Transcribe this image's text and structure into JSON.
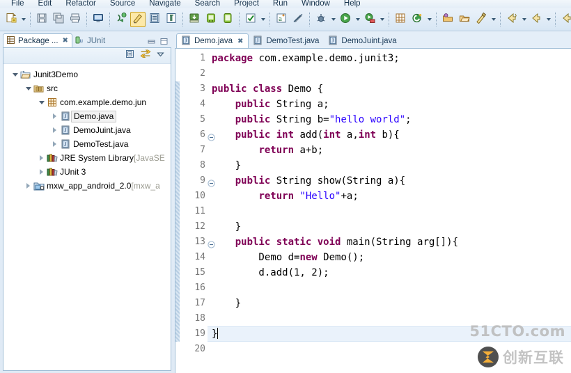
{
  "menu": {
    "items": [
      "File",
      "Edit",
      "Refactor",
      "Source",
      "Navigate",
      "Search",
      "Project",
      "Run",
      "Window",
      "Help"
    ]
  },
  "toolbar": {
    "groups": [
      {
        "buttons": [
          {
            "name": "new-wizard-icon",
            "label": "New"
          },
          {
            "name": "new-dropdown-arrow",
            "label": "New options"
          }
        ]
      },
      {
        "buttons": [
          {
            "name": "save-icon",
            "label": "Save"
          },
          {
            "name": "save-all-icon",
            "label": "Save All"
          },
          {
            "name": "print-icon",
            "label": "Print"
          }
        ]
      },
      {
        "buttons": [
          {
            "name": "open-console-icon",
            "label": "Open Console"
          }
        ]
      },
      {
        "buttons": [
          {
            "name": "new-java-class-icon",
            "label": "New Java Class"
          },
          {
            "name": "toggle-mark-occurrences-icon",
            "label": "Toggle Mark Occurrences"
          },
          {
            "name": "open-task-icon",
            "label": "Open Task"
          },
          {
            "name": "show-whitespace-icon",
            "label": "Show Whitespace Characters"
          }
        ]
      },
      {
        "buttons": [
          {
            "name": "import-icon",
            "label": "Import"
          },
          {
            "name": "android-sdk-manager-icon",
            "label": "Android SDK Manager"
          },
          {
            "name": "android-virtual-device-icon",
            "label": "Android Virtual Device Manager"
          }
        ]
      },
      {
        "buttons": [
          {
            "name": "check-icon",
            "label": "Validate"
          },
          {
            "name": "check-dropdown-arrow",
            "label": "Validate options"
          }
        ]
      },
      {
        "buttons": [
          {
            "name": "annotation-icon",
            "label": "Annotations"
          },
          {
            "name": "disable-icon",
            "label": "Skip All Breakpoints"
          }
        ]
      },
      {
        "buttons": [
          {
            "name": "debug-icon",
            "label": "Debug"
          },
          {
            "name": "debug-dropdown-arrow",
            "label": "Debug configurations"
          },
          {
            "name": "run-icon",
            "label": "Run"
          },
          {
            "name": "run-dropdown-arrow",
            "label": "Run configurations"
          },
          {
            "name": "run-coverage-icon",
            "label": "Coverage"
          },
          {
            "name": "coverage-dropdown-arrow",
            "label": "Coverage configurations"
          }
        ]
      },
      {
        "buttons": [
          {
            "name": "new-package-icon",
            "label": "New Package"
          },
          {
            "name": "new-project-icon",
            "label": "New Project"
          },
          {
            "name": "new-project-dropdown-arrow",
            "label": "New project options"
          }
        ]
      },
      {
        "buttons": [
          {
            "name": "open-type-icon",
            "label": "Open Type"
          },
          {
            "name": "open-resource-icon",
            "label": "Open Resource"
          },
          {
            "name": "quick-fix-icon",
            "label": "Quick Fix"
          },
          {
            "name": "quick-fix-dropdown-arrow",
            "label": "Quick fix options"
          }
        ]
      },
      {
        "buttons": [
          {
            "name": "next-annotation-icon",
            "label": "Next Annotation"
          },
          {
            "name": "next-annotation-dropdown-arrow",
            "label": "Next annotation options"
          },
          {
            "name": "previous-annotation-icon",
            "label": "Previous Annotation"
          },
          {
            "name": "previous-annotation-dropdown-arrow",
            "label": "Previous annotation options"
          }
        ]
      },
      {
        "buttons": [
          {
            "name": "back-history-icon",
            "label": "Back"
          },
          {
            "name": "forward-history-icon",
            "label": "Forward"
          },
          {
            "name": "forward-dropdown-arrow",
            "label": "Forward options"
          }
        ]
      }
    ]
  },
  "left_panel": {
    "tabs": [
      {
        "label": "Package ...",
        "icon": "package-explorer-icon",
        "active": true,
        "closable": true
      },
      {
        "label": "JUnit",
        "icon": "junit-icon",
        "active": false,
        "closable": false
      }
    ],
    "window_controls": [
      {
        "name": "minimize-button",
        "label": "Minimize"
      },
      {
        "name": "maximize-button",
        "label": "Maximize"
      }
    ],
    "view_toolbar": [
      {
        "name": "collapse-all-icon",
        "label": "Collapse All"
      },
      {
        "name": "link-with-editor-icon",
        "label": "Link with Editor"
      },
      {
        "name": "view-menu-icon",
        "label": "View Menu"
      }
    ],
    "tree": [
      {
        "label": "Junit3Demo",
        "suffix": "",
        "indent": 0,
        "twisty": "open",
        "icon": "java-project-icon",
        "selected": false
      },
      {
        "label": "src",
        "suffix": "",
        "indent": 1,
        "twisty": "open",
        "icon": "source-folder-icon",
        "selected": false
      },
      {
        "label": "com.example.demo.jun",
        "suffix": "",
        "indent": 2,
        "twisty": "open",
        "icon": "package-icon",
        "selected": false
      },
      {
        "label": "Demo.java",
        "suffix": "",
        "indent": 3,
        "twisty": "closed",
        "icon": "java-file-icon",
        "selected": true
      },
      {
        "label": "DemoJuint.java",
        "suffix": "",
        "indent": 3,
        "twisty": "closed",
        "icon": "java-file-icon",
        "selected": false
      },
      {
        "label": "DemoTest.java",
        "suffix": "",
        "indent": 3,
        "twisty": "closed",
        "icon": "java-file-icon",
        "selected": false
      },
      {
        "label": "JRE System Library",
        "suffix": "[JavaSE",
        "indent": 2,
        "twisty": "closed",
        "icon": "library-icon",
        "selected": false
      },
      {
        "label": "JUnit 3",
        "suffix": "",
        "indent": 2,
        "twisty": "closed",
        "icon": "library-icon",
        "selected": false
      },
      {
        "label": "mxw_app_android_2.0",
        "suffix": "[mxw_a",
        "indent": 1,
        "twisty": "closed",
        "icon": "android-project-icon",
        "selected": false
      }
    ]
  },
  "editor": {
    "tabs": [
      {
        "label": "Demo.java",
        "icon": "java-file-icon",
        "active": true,
        "closable": true
      },
      {
        "label": "DemoTest.java",
        "icon": "java-file-icon",
        "active": false,
        "closable": false
      },
      {
        "label": "DemoJuint.java",
        "icon": "java-file-icon",
        "active": false,
        "closable": false
      }
    ],
    "lines": [
      {
        "num": "1",
        "fold": false,
        "changed": false,
        "current": false,
        "tokens": [
          {
            "t": "package",
            "c": "kw"
          },
          {
            "t": " com.example.demo.junit3;",
            "c": ""
          }
        ]
      },
      {
        "num": "2",
        "fold": false,
        "changed": false,
        "current": false,
        "tokens": []
      },
      {
        "num": "3",
        "fold": false,
        "changed": true,
        "current": false,
        "tokens": [
          {
            "t": "public class",
            "c": "kw"
          },
          {
            "t": " Demo {",
            "c": ""
          }
        ]
      },
      {
        "num": "4",
        "fold": false,
        "changed": true,
        "current": false,
        "tokens": [
          {
            "t": "    ",
            "c": ""
          },
          {
            "t": "public",
            "c": "kw"
          },
          {
            "t": " String a;",
            "c": ""
          }
        ]
      },
      {
        "num": "5",
        "fold": false,
        "changed": true,
        "current": false,
        "tokens": [
          {
            "t": "    ",
            "c": ""
          },
          {
            "t": "public",
            "c": "kw"
          },
          {
            "t": " String b=",
            "c": ""
          },
          {
            "t": "\"hello world\"",
            "c": "str"
          },
          {
            "t": ";",
            "c": ""
          }
        ]
      },
      {
        "num": "6",
        "fold": true,
        "changed": true,
        "current": false,
        "tokens": [
          {
            "t": "    ",
            "c": ""
          },
          {
            "t": "public int",
            "c": "kw"
          },
          {
            "t": " add(",
            "c": ""
          },
          {
            "t": "int",
            "c": "kw"
          },
          {
            "t": " a,",
            "c": ""
          },
          {
            "t": "int",
            "c": "kw"
          },
          {
            "t": " b){",
            "c": ""
          }
        ]
      },
      {
        "num": "7",
        "fold": false,
        "changed": true,
        "current": false,
        "tokens": [
          {
            "t": "        ",
            "c": ""
          },
          {
            "t": "return",
            "c": "kw"
          },
          {
            "t": " a+b;",
            "c": ""
          }
        ]
      },
      {
        "num": "8",
        "fold": false,
        "changed": true,
        "current": false,
        "tokens": [
          {
            "t": "    }",
            "c": ""
          }
        ]
      },
      {
        "num": "9",
        "fold": true,
        "changed": true,
        "current": false,
        "tokens": [
          {
            "t": "    ",
            "c": ""
          },
          {
            "t": "public",
            "c": "kw"
          },
          {
            "t": " String show(String a){",
            "c": ""
          }
        ]
      },
      {
        "num": "10",
        "fold": false,
        "changed": true,
        "current": false,
        "tokens": [
          {
            "t": "        ",
            "c": ""
          },
          {
            "t": "return",
            "c": "kw"
          },
          {
            "t": " ",
            "c": ""
          },
          {
            "t": "\"Hello\"",
            "c": "str"
          },
          {
            "t": "+a;",
            "c": ""
          }
        ]
      },
      {
        "num": "11",
        "fold": false,
        "changed": true,
        "current": false,
        "tokens": []
      },
      {
        "num": "12",
        "fold": false,
        "changed": true,
        "current": false,
        "tokens": [
          {
            "t": "    }",
            "c": ""
          }
        ]
      },
      {
        "num": "13",
        "fold": true,
        "changed": true,
        "current": false,
        "tokens": [
          {
            "t": "    ",
            "c": ""
          },
          {
            "t": "public static void",
            "c": "kw"
          },
          {
            "t": " main(String arg[]){",
            "c": ""
          }
        ]
      },
      {
        "num": "14",
        "fold": false,
        "changed": true,
        "current": false,
        "tokens": [
          {
            "t": "        Demo d=",
            "c": ""
          },
          {
            "t": "new",
            "c": "kw"
          },
          {
            "t": " Demo();",
            "c": ""
          }
        ]
      },
      {
        "num": "15",
        "fold": false,
        "changed": true,
        "current": false,
        "tokens": [
          {
            "t": "        d.add(1, 2);",
            "c": ""
          }
        ]
      },
      {
        "num": "16",
        "fold": false,
        "changed": true,
        "current": false,
        "tokens": []
      },
      {
        "num": "17",
        "fold": false,
        "changed": true,
        "current": false,
        "tokens": [
          {
            "t": "    }",
            "c": ""
          }
        ]
      },
      {
        "num": "18",
        "fold": false,
        "changed": true,
        "current": false,
        "tokens": []
      },
      {
        "num": "19",
        "fold": false,
        "changed": true,
        "current": true,
        "tokens": [
          {
            "t": "}",
            "c": ""
          }
        ]
      },
      {
        "num": "20",
        "fold": false,
        "changed": false,
        "current": false,
        "tokens": []
      }
    ]
  },
  "watermarks": {
    "site_text": "51CTO.com",
    "logo_text": "创新互联"
  },
  "colors": {
    "keyword": "#7f0055",
    "string": "#2a00ff",
    "chrome": "#dce8f4",
    "selection": "#eaf2fb"
  }
}
